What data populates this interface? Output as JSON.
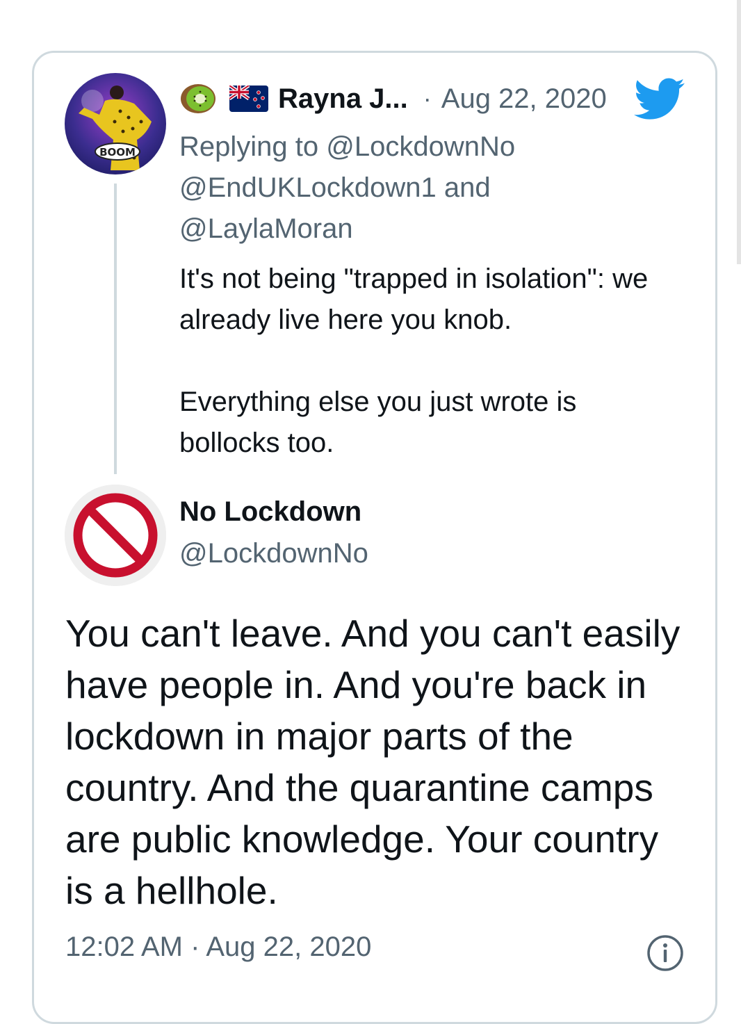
{
  "reply_tweet": {
    "author_name": "Rayna J...",
    "date": "Aug 22, 2020",
    "separator": "·",
    "replying_prefix": "Replying to",
    "mention_1": "@LockdownNo",
    "mention_2": "@EndUKLockdown1",
    "connector": "and",
    "mention_3": "@LaylaMoran",
    "paragraph_1": "It's not being \"trapped in isolation\": we already live here you knob.",
    "paragraph_2": "Everything else you just wrote is bollocks too.",
    "avatar_caption": "BOOM"
  },
  "main_tweet": {
    "author_name": "No Lockdown",
    "handle": "@LockdownNo",
    "text": "You can't leave. And you can't easily have people in. And you're back in lockdown in major parts of the country. And the quarantine camps are public knowledge. Your country is a hellhole.",
    "time": "12:02 AM",
    "separator": "·",
    "date": "Aug 22, 2020"
  },
  "icons": {
    "kiwi": "kiwi-fruit-icon",
    "flag": "new-zealand-flag-icon",
    "bird": "twitter-bird-icon",
    "info": "info-icon",
    "prohibited": "prohibited-sign-icon"
  },
  "colors": {
    "accent": "#1d9bf0",
    "secondary_text": "#536471",
    "primary_text": "#0f1419",
    "border": "#cfd9de",
    "prohibited_red": "#c8102e"
  }
}
